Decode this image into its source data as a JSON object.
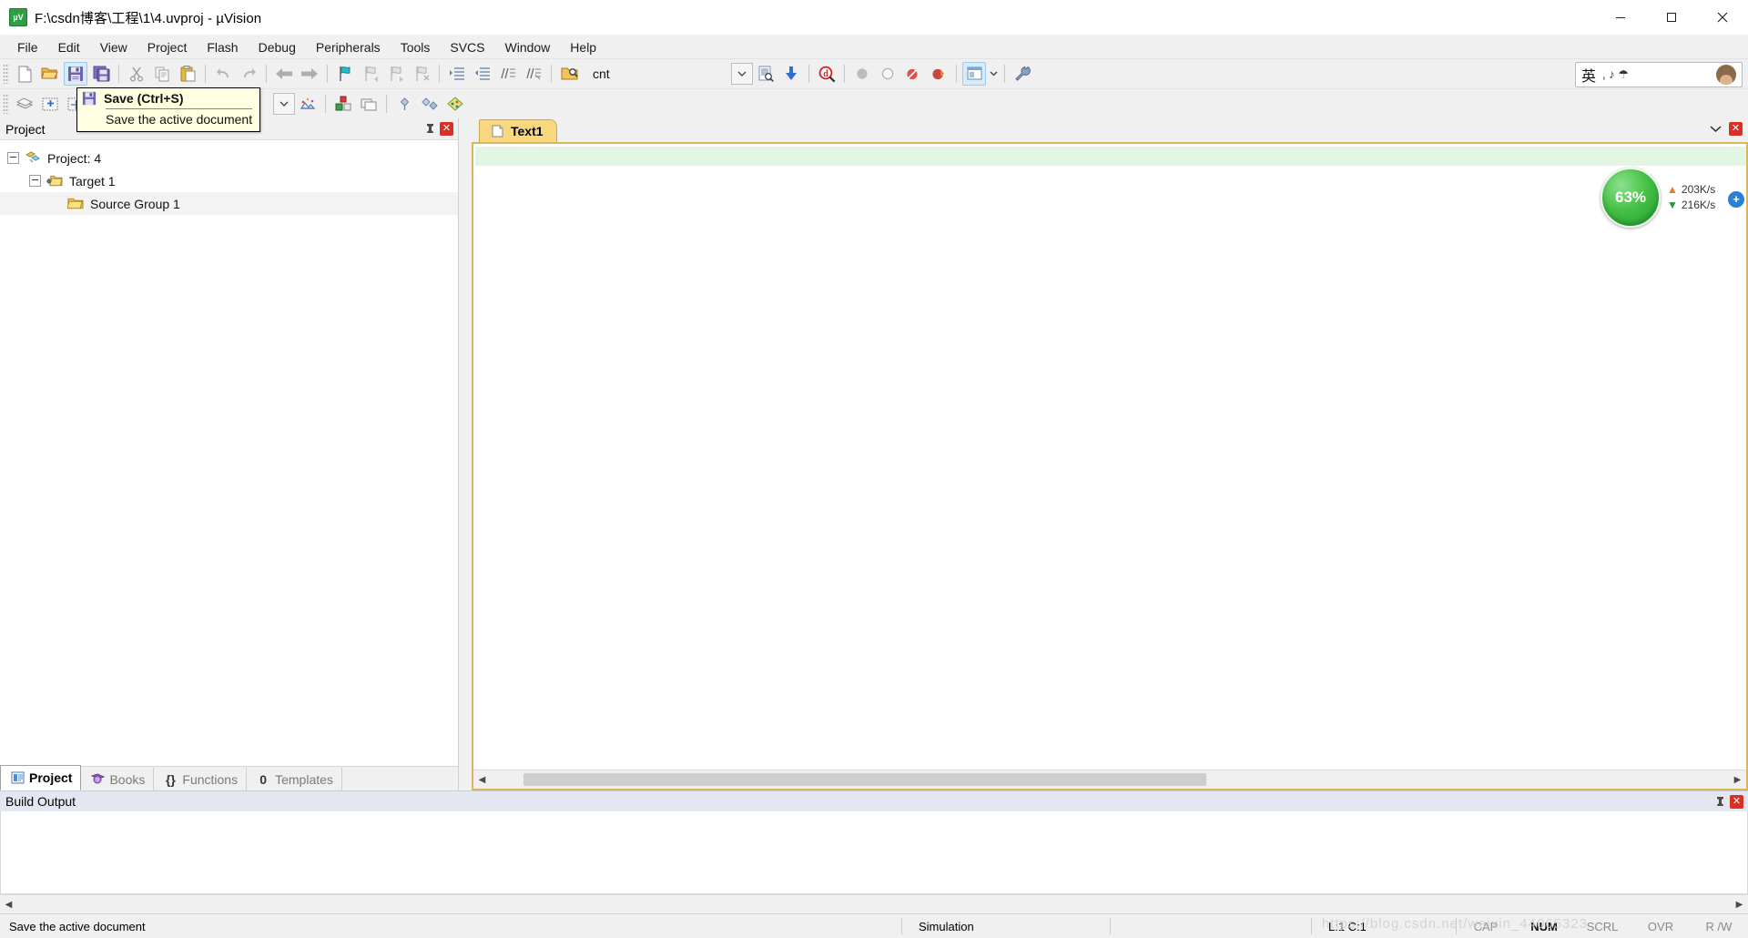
{
  "window": {
    "title": "F:\\csdn博客\\工程\\1\\4.uvproj - µVision",
    "app_icon": "uvision-icon",
    "minimize": "minimize-button",
    "maximize": "maximize-button",
    "close": "close-button"
  },
  "menubar": {
    "items": [
      {
        "label": "File"
      },
      {
        "label": "Edit"
      },
      {
        "label": "View"
      },
      {
        "label": "Project"
      },
      {
        "label": "Flash"
      },
      {
        "label": "Debug"
      },
      {
        "label": "Peripherals"
      },
      {
        "label": "Tools"
      },
      {
        "label": "SVCS"
      },
      {
        "label": "Window"
      },
      {
        "label": "Help"
      }
    ]
  },
  "toolbar_main": {
    "buttons": [
      {
        "name": "new-file-icon",
        "title": "New"
      },
      {
        "name": "open-file-icon",
        "title": "Open"
      },
      {
        "name": "save-icon",
        "title": "Save",
        "active": true
      },
      {
        "name": "save-all-icon",
        "title": "Save All"
      },
      {
        "name": "cut-icon",
        "title": "Cut"
      },
      {
        "name": "copy-icon",
        "title": "Copy"
      },
      {
        "name": "paste-icon",
        "title": "Paste"
      },
      {
        "name": "undo-icon",
        "title": "Undo"
      },
      {
        "name": "redo-icon",
        "title": "Redo"
      },
      {
        "name": "navigate-back-icon",
        "title": "Back"
      },
      {
        "name": "navigate-forward-icon",
        "title": "Forward"
      },
      {
        "name": "bookmark-toggle-icon",
        "title": "Insert/Remove Bookmark"
      },
      {
        "name": "bookmark-prev-icon",
        "title": "Previous Bookmark"
      },
      {
        "name": "bookmark-next-icon",
        "title": "Next Bookmark"
      },
      {
        "name": "bookmark-clear-icon",
        "title": "Clear All Bookmarks"
      },
      {
        "name": "indent-icon",
        "title": "Indent"
      },
      {
        "name": "outdent-icon",
        "title": "Outdent"
      },
      {
        "name": "comment-icon",
        "title": "Comment"
      },
      {
        "name": "uncomment-icon",
        "title": "Uncomment"
      },
      {
        "name": "find-in-files-icon",
        "title": "Find in Files"
      }
    ],
    "search_value": "cnt",
    "search_placeholder": "",
    "dropdown_arrow": "chevron-down-icon",
    "right_buttons": [
      {
        "name": "browse-symbol-icon"
      },
      {
        "name": "insert-snippet-icon"
      },
      {
        "name": "find-icon"
      },
      {
        "name": "breakpoint-gray-icon"
      },
      {
        "name": "breakpoint-outline-icon"
      },
      {
        "name": "breakpoint-disable-icon"
      },
      {
        "name": "breakpoint-kill-icon"
      },
      {
        "name": "window-layout-icon"
      },
      {
        "name": "configure-icon"
      }
    ]
  },
  "toolbar_build": {
    "buttons": [
      {
        "name": "translate-icon"
      },
      {
        "name": "build-target-icon"
      },
      {
        "name": "rebuild-all-icon"
      },
      {
        "name": "batch-build-icon"
      },
      {
        "name": "stop-build-icon"
      },
      {
        "name": "download-icon"
      },
      {
        "name": "target-options-icon"
      },
      {
        "name": "manage-components-icon"
      },
      {
        "name": "pack-installer-icon"
      }
    ],
    "target_dropdown_arrow": "chevron-down-icon"
  },
  "ime": {
    "language": "英",
    "glyphs": ", ♪ ☂",
    "avatar": "user-avatar"
  },
  "tooltip": {
    "icon": "save-icon",
    "title": "Save (Ctrl+S)",
    "description": "Save the active document"
  },
  "project_panel": {
    "title": "Project",
    "pin": "pin-icon",
    "close": "close-icon",
    "tree": [
      {
        "label": "Project: 4",
        "level": 1,
        "icon": "project-icon",
        "expanded": true
      },
      {
        "label": "Target 1",
        "level": 2,
        "icon": "target-folder-icon",
        "expanded": true
      },
      {
        "label": "Source Group 1",
        "level": 3,
        "icon": "folder-icon",
        "expanded": false,
        "selected": true
      }
    ],
    "tabs": [
      {
        "label": "Project",
        "icon": "project-tab-icon",
        "active": true
      },
      {
        "label": "Books",
        "icon": "books-tab-icon",
        "active": false
      },
      {
        "label": "Functions",
        "icon": "functions-tab-icon",
        "active": false
      },
      {
        "label": "Templates",
        "icon": "templates-tab-icon",
        "active": false
      }
    ]
  },
  "editor": {
    "tabs": [
      {
        "label": "Text1",
        "icon": "document-icon",
        "active": true
      }
    ],
    "minimize": "chevron-down-icon",
    "close": "close-icon",
    "content": ""
  },
  "net_badge": {
    "percent": "63%",
    "upload": "203K/s",
    "download": "216K/s",
    "upload_icon": "arrow-up-icon",
    "download_icon": "arrow-down-icon",
    "plus": "+"
  },
  "build_output": {
    "title": "Build Output",
    "pin": "pin-icon",
    "close": "close-icon",
    "content": ""
  },
  "statusbar": {
    "message": "Save the active document",
    "mode": "Simulation",
    "blank": "",
    "position": "L:1 C:1",
    "flags": [
      {
        "label": "CAP",
        "on": false
      },
      {
        "label": "NUM",
        "on": true
      },
      {
        "label": "SCRL",
        "on": false
      },
      {
        "label": "OVR",
        "on": false
      },
      {
        "label": "R /W",
        "on": false
      }
    ],
    "watermark": "https://blog.csdn.net/weixin_44065323"
  },
  "colors": {
    "tab_active": "#f9d77e",
    "editor_frame": "#d9b659",
    "current_line": "#e3f6e3",
    "close_red": "#d93025",
    "badge_green": "#46c246",
    "tooltip_bg": "#ffffe1"
  }
}
